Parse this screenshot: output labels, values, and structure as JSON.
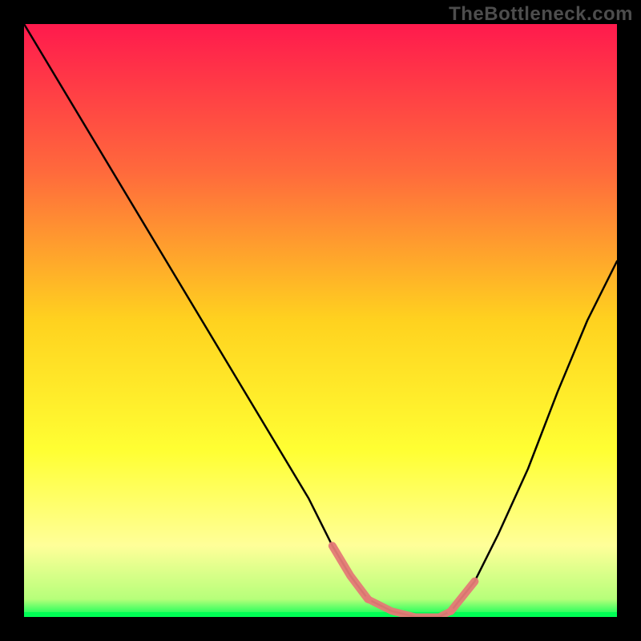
{
  "watermark": "TheBottleneck.com",
  "chart_data": {
    "type": "line",
    "title": "",
    "xlabel": "",
    "ylabel": "",
    "xlim": [
      0,
      100
    ],
    "ylim": [
      0,
      100
    ],
    "series": [
      {
        "name": "curve",
        "color": "#000000",
        "x": [
          0,
          6,
          12,
          18,
          24,
          30,
          36,
          42,
          48,
          52,
          55,
          58,
          62,
          66,
          70,
          72,
          76,
          80,
          85,
          90,
          95,
          100
        ],
        "y": [
          100,
          90,
          80,
          70,
          60,
          50,
          40,
          30,
          20,
          12,
          7,
          3,
          1,
          0,
          0,
          1,
          6,
          14,
          25,
          38,
          50,
          60
        ]
      },
      {
        "name": "band-bottom",
        "color": "#00ff55",
        "x": [
          0,
          100
        ],
        "y": [
          0,
          0
        ]
      },
      {
        "name": "highlight-left",
        "color": "#e47a76",
        "x": [
          52,
          55,
          58
        ],
        "y": [
          12,
          7,
          3
        ]
      },
      {
        "name": "highlight-flat",
        "color": "#e47a76",
        "x": [
          58,
          62,
          66,
          70,
          72
        ],
        "y": [
          3,
          1,
          0,
          0,
          1
        ]
      },
      {
        "name": "highlight-right",
        "color": "#e47a76",
        "x": [
          72,
          76
        ],
        "y": [
          1,
          6
        ]
      }
    ],
    "gradient_stops": [
      {
        "offset": 0.0,
        "color": "#ff1a4d"
      },
      {
        "offset": 0.25,
        "color": "#ff6a3c"
      },
      {
        "offset": 0.5,
        "color": "#ffd21f"
      },
      {
        "offset": 0.72,
        "color": "#ffff33"
      },
      {
        "offset": 0.88,
        "color": "#ffff99"
      },
      {
        "offset": 0.97,
        "color": "#b6ff7a"
      },
      {
        "offset": 1.0,
        "color": "#00ff55"
      }
    ]
  }
}
